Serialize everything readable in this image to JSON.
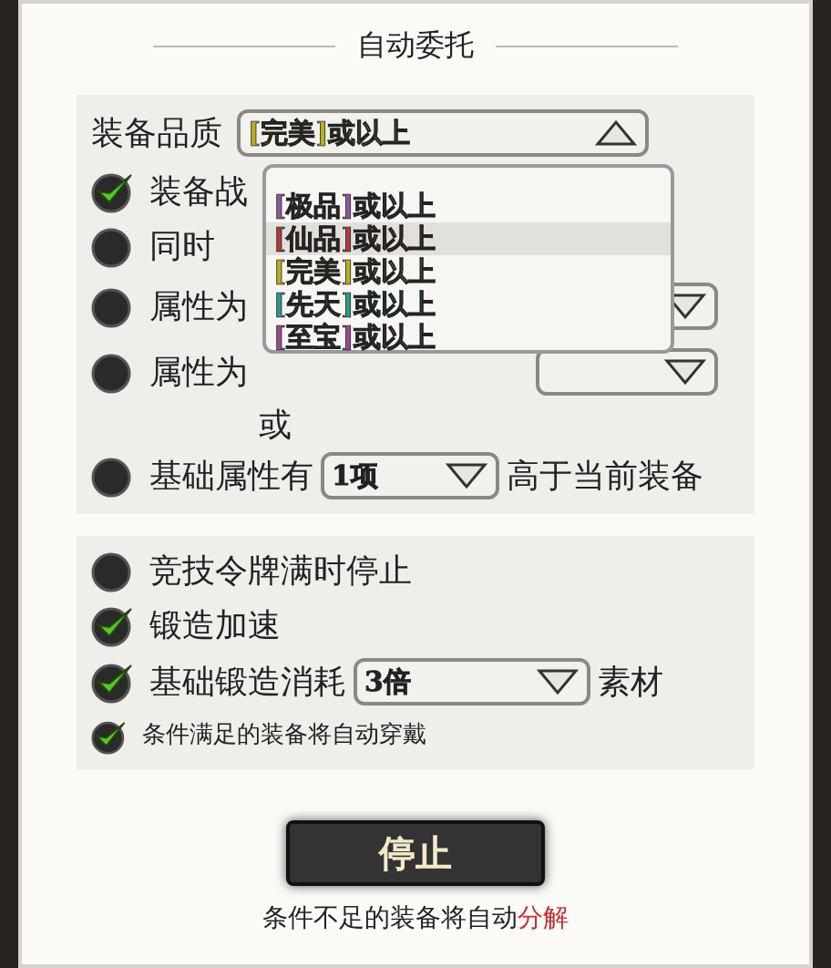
{
  "dialog": {
    "title": "自动委托"
  },
  "quality": {
    "label": "装备品质",
    "value": "[完美]或以上",
    "color": "#b8b020",
    "expanded": true,
    "options": [
      {
        "label": "[极品]或以上",
        "color": "#8a5a9a",
        "highlighted": false
      },
      {
        "label": "[仙品]或以上",
        "color": "#b03a3a",
        "highlighted": true
      },
      {
        "label": "[完美]或以上",
        "color": "#b8b020",
        "highlighted": false
      },
      {
        "label": "[先天]或以上",
        "color": "#2a9a8a",
        "highlighted": false
      },
      {
        "label": "[至宝]或以上",
        "color": "#9a4a8a",
        "highlighted": false
      }
    ]
  },
  "conditions": [
    {
      "kind": "check",
      "checked": true,
      "label": "装备战"
    },
    {
      "kind": "check",
      "checked": false,
      "label": "同时"
    },
    {
      "kind": "pair",
      "checked": false,
      "label": "属性为"
    },
    {
      "kind": "pair",
      "checked": false,
      "label": "属性为"
    },
    {
      "kind": "or",
      "label": "或"
    },
    {
      "kind": "compare",
      "checked": false,
      "label": "基础属性有",
      "value": "1项",
      "suffix": "高于当前装备"
    }
  ],
  "settings": [
    {
      "kind": "check",
      "checked": false,
      "label": "竞技令牌满时停止"
    },
    {
      "kind": "check",
      "checked": true,
      "label": "锻造加速"
    },
    {
      "kind": "select",
      "checked": true,
      "label": "基础锻造消耗",
      "value": "3倍",
      "suffix": "素材"
    },
    {
      "kind": "small",
      "checked": true,
      "label": "条件满足的装备将自动穿戴"
    }
  ],
  "stop_button": "停止",
  "footer": {
    "text": "条件不足的装备将自动",
    "highlight": "分解"
  }
}
